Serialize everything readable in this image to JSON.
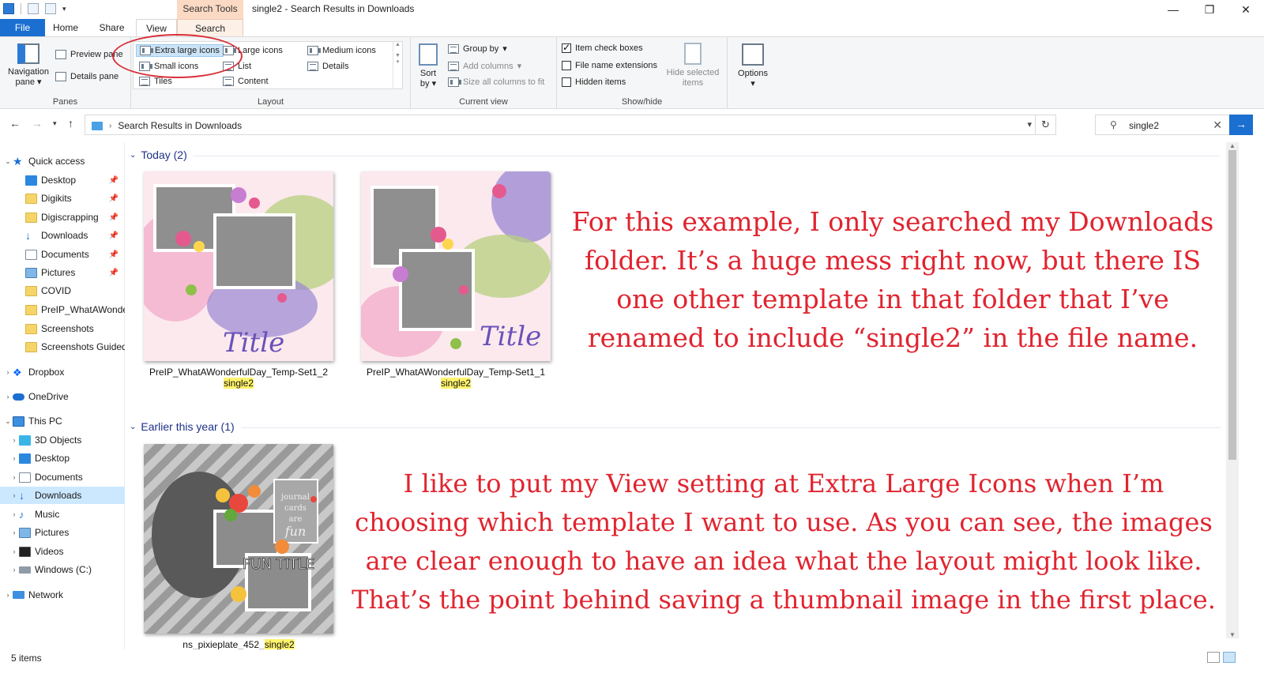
{
  "window": {
    "title": "single2 - Search Results in Downloads",
    "context_tab": "Search Tools"
  },
  "ribbon_tabs": [
    {
      "label": "File"
    },
    {
      "label": "Home"
    },
    {
      "label": "Share"
    },
    {
      "label": "View"
    },
    {
      "label": "Search"
    }
  ],
  "ribbon": {
    "panes": {
      "label": "Panes",
      "navigation_pane": "Navigation pane",
      "preview_pane": "Preview pane",
      "details_pane": "Details pane"
    },
    "layout": {
      "label": "Layout",
      "options": [
        "Extra large icons",
        "Large icons",
        "Medium icons",
        "Small icons",
        "List",
        "Details",
        "Tiles",
        "Content"
      ],
      "selected": "Extra large icons"
    },
    "current_view": {
      "label": "Current view",
      "sort_by": "Sort by",
      "group_by": "Group by",
      "add_columns": "Add columns",
      "size_all_columns": "Size all columns to fit"
    },
    "show_hide": {
      "label": "Show/hide",
      "item_check_boxes": "Item check boxes",
      "file_name_extensions": "File name extensions",
      "hidden_items": "Hidden items",
      "hide_selected_items": "Hide selected items",
      "item_check_boxes_checked": true,
      "file_name_extensions_checked": false,
      "hidden_items_checked": false
    },
    "options": {
      "label": "Options"
    }
  },
  "address": {
    "path": "Search Results in Downloads",
    "search_value": "single2"
  },
  "nav": {
    "quick_access": {
      "label": "Quick access",
      "items": [
        {
          "label": "Desktop"
        },
        {
          "label": "Digikits"
        },
        {
          "label": "Digiscrapping"
        },
        {
          "label": "Downloads"
        },
        {
          "label": "Documents"
        },
        {
          "label": "Pictures"
        },
        {
          "label": "COVID"
        },
        {
          "label": "PreIP_WhatAWonderfulDay"
        },
        {
          "label": "Screenshots"
        },
        {
          "label": "Screenshots Guided"
        }
      ]
    },
    "dropbox": "Dropbox",
    "onedrive": "OneDrive",
    "this_pc": {
      "label": "This PC",
      "items": [
        {
          "label": "3D Objects"
        },
        {
          "label": "Desktop"
        },
        {
          "label": "Documents"
        },
        {
          "label": "Downloads"
        },
        {
          "label": "Music"
        },
        {
          "label": "Pictures"
        },
        {
          "label": "Videos"
        },
        {
          "label": "Windows (C:)"
        }
      ]
    },
    "network": "Network"
  },
  "groups": [
    {
      "header": "Today (2)",
      "files": [
        {
          "name": "PreIP_WhatAWonderfulDay_Temp-Set1_2",
          "match": "single2"
        },
        {
          "name": "PreIP_WhatAWonderfulDay_Temp-Set1_1",
          "match": "single2"
        }
      ]
    },
    {
      "header": "Earlier this year (1)",
      "files": [
        {
          "name": "ns_pixieplate_452_",
          "match": "single2"
        }
      ]
    }
  ],
  "thumbnails": {
    "template_title": "Title",
    "journal": "journal cards are fun",
    "fun_title": "FUN TITLE"
  },
  "annotations": {
    "top": "For this example, I only searched my Downloads folder. It’s a huge mess right now, but there IS one other template in that folder that I’ve renamed to include “single2” in the file name.",
    "bottom": "I like to put my View setting at Extra Large Icons when I’m choosing which template I want to use. As you can see, the images are clear enough to have an idea what the layout might look like. That’s the point behind saving a thumbnail image in the first place."
  },
  "status": {
    "item_count": "5 items"
  },
  "colors": {
    "accent": "#1a6fd0",
    "annotation": "#e0242f",
    "highlight": "#fff36b",
    "selected": "#cce8ff"
  }
}
